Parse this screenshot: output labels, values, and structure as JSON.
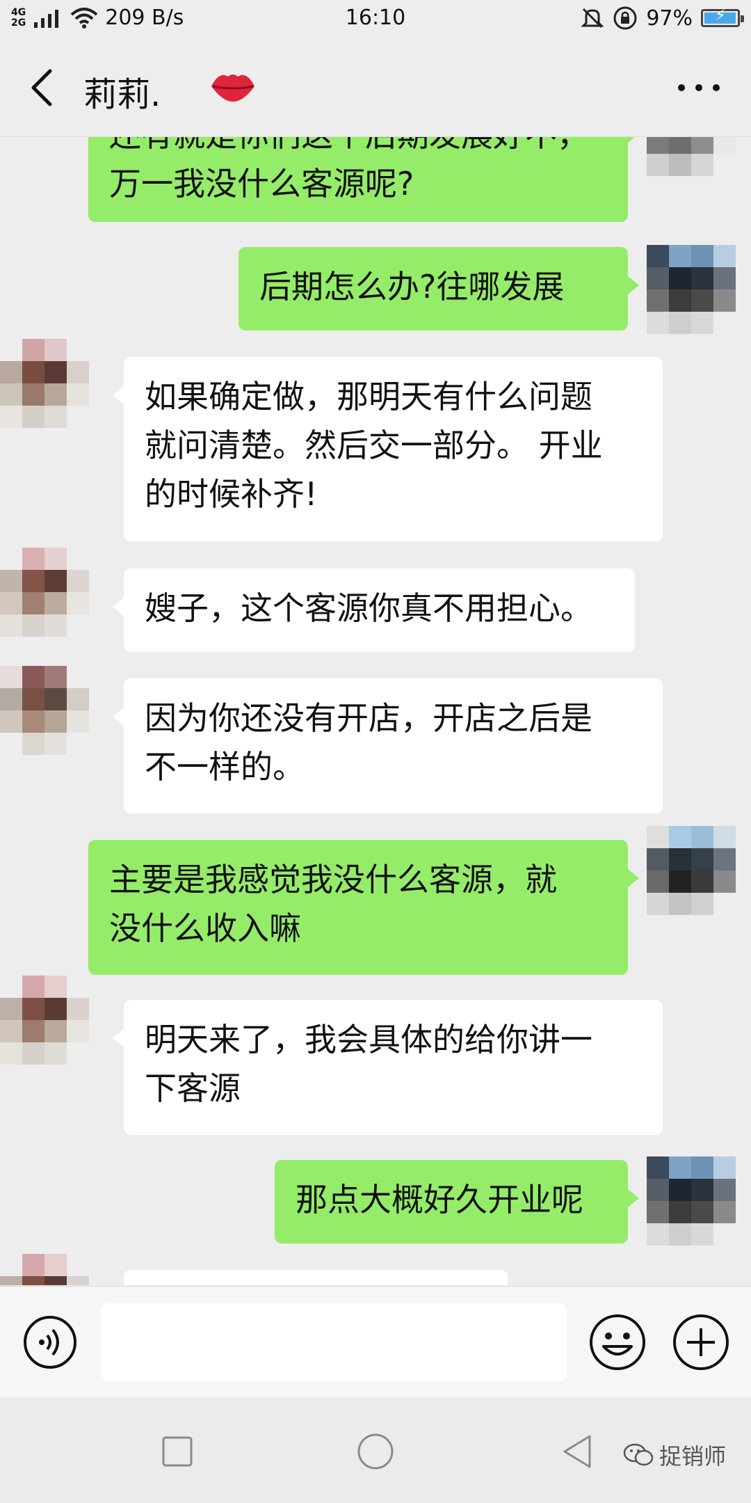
{
  "status_bar": {
    "network": "4G\n2G",
    "speed": "209 B/s",
    "time": "16:10",
    "battery": "97%",
    "battery_level": 0.97,
    "accent": "#4aa8e8"
  },
  "header": {
    "title": "莉莉.",
    "back_icon": "chevron-left-icon",
    "emoji": "lips-icon",
    "more_icon": "more-dots-icon"
  },
  "messages": [
    {
      "side": "out",
      "text": "还有就是你们这个后期发展好不，\n万一我没什么客源呢?"
    },
    {
      "side": "out",
      "text": "后期怎么办?往哪发展"
    },
    {
      "side": "in",
      "text": "如果确定做，那明天有什么问题\n就问清楚。然后交一部分。 开业\n的时候补齐!"
    },
    {
      "side": "in",
      "text": "嫂子，这个客源你真不用担心。"
    },
    {
      "side": "in",
      "text": "因为你还没有开店，开店之后是\n不一样的。"
    },
    {
      "side": "out",
      "text": "主要是我感觉我没什么客源，就\n没什么收入嘛"
    },
    {
      "side": "in",
      "text": "明天来了，我会具体的给你讲一\n下客源"
    },
    {
      "side": "out",
      "text": "那点大概好久开业呢"
    },
    {
      "side": "in",
      "text": ""
    }
  ],
  "colors": {
    "outgoing_bubble": "#95ec69",
    "incoming_bubble": "#ffffff",
    "background": "#ededed"
  },
  "input_bar": {
    "voice_icon": "voice-icon",
    "input_value": "",
    "emoji_icon": "emoji-icon",
    "plus_icon": "plus-icon"
  },
  "nav": {
    "watermark": "捉销师"
  }
}
